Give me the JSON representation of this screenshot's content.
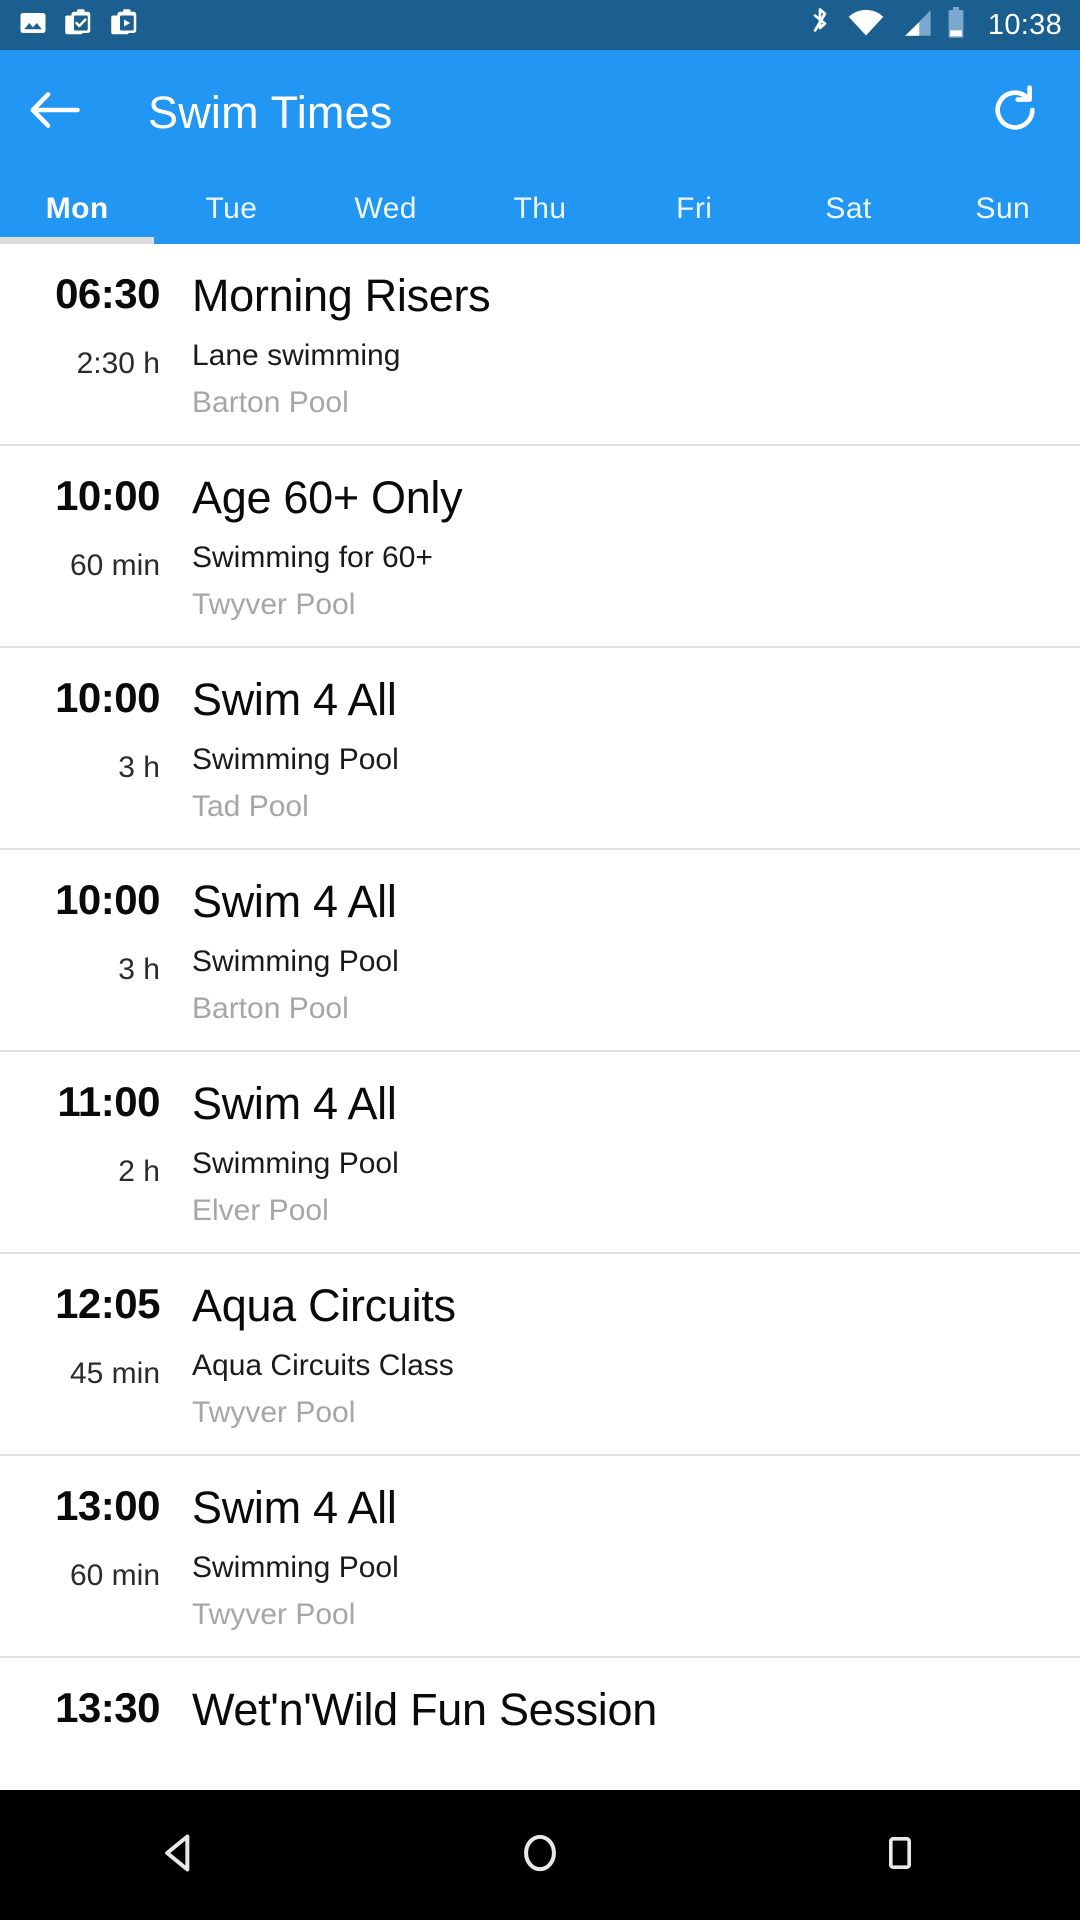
{
  "status_bar": {
    "time": "10:38",
    "left_icons": [
      "image-icon",
      "clipboard-check-icon",
      "clipboard-play-icon"
    ],
    "right_icons": [
      "bluetooth-icon",
      "wifi-icon",
      "cellular-signal-icon",
      "battery-icon"
    ],
    "background_color": "#1b5e90"
  },
  "app_bar": {
    "title": "Swim Times",
    "back_icon": "back-arrow-icon",
    "refresh_icon": "refresh-icon",
    "background_color": "#2196F3"
  },
  "tabs": {
    "items": [
      {
        "label": "Mon",
        "active": true
      },
      {
        "label": "Tue",
        "active": false
      },
      {
        "label": "Wed",
        "active": false
      },
      {
        "label": "Thu",
        "active": false
      },
      {
        "label": "Fri",
        "active": false
      },
      {
        "label": "Sat",
        "active": false
      },
      {
        "label": "Sun",
        "active": false
      }
    ],
    "indicator_color": "#dcdcdc"
  },
  "sessions": [
    {
      "time": "06:30",
      "duration": "2:30 h",
      "title": "Morning Risers",
      "subtitle": "Lane swimming",
      "venue": "Barton Pool"
    },
    {
      "time": "10:00",
      "duration": "60 min",
      "title": "Age 60+ Only",
      "subtitle": "Swimming for 60+",
      "venue": "Twyver Pool"
    },
    {
      "time": "10:00",
      "duration": "3 h",
      "title": "Swim 4 All",
      "subtitle": "Swimming Pool",
      "venue": "Tad Pool"
    },
    {
      "time": "10:00",
      "duration": "3 h",
      "title": "Swim 4 All",
      "subtitle": "Swimming Pool",
      "venue": "Barton Pool"
    },
    {
      "time": "11:00",
      "duration": "2 h",
      "title": "Swim 4 All",
      "subtitle": "Swimming Pool",
      "venue": "Elver Pool"
    },
    {
      "time": "12:05",
      "duration": "45 min",
      "title": "Aqua Circuits",
      "subtitle": "Aqua Circuits Class",
      "venue": "Twyver Pool"
    },
    {
      "time": "13:00",
      "duration": "60 min",
      "title": "Swim 4 All",
      "subtitle": "Swimming Pool",
      "venue": "Twyver Pool"
    },
    {
      "time": "13:30",
      "duration": "",
      "title": "Wet'n'Wild Fun Session",
      "subtitle": "",
      "venue": ""
    }
  ],
  "nav_bar": {
    "back_icon": "nav-back-triangle-icon",
    "home_icon": "nav-home-circle-icon",
    "recents_icon": "nav-recents-square-icon",
    "background_color": "#000000"
  }
}
